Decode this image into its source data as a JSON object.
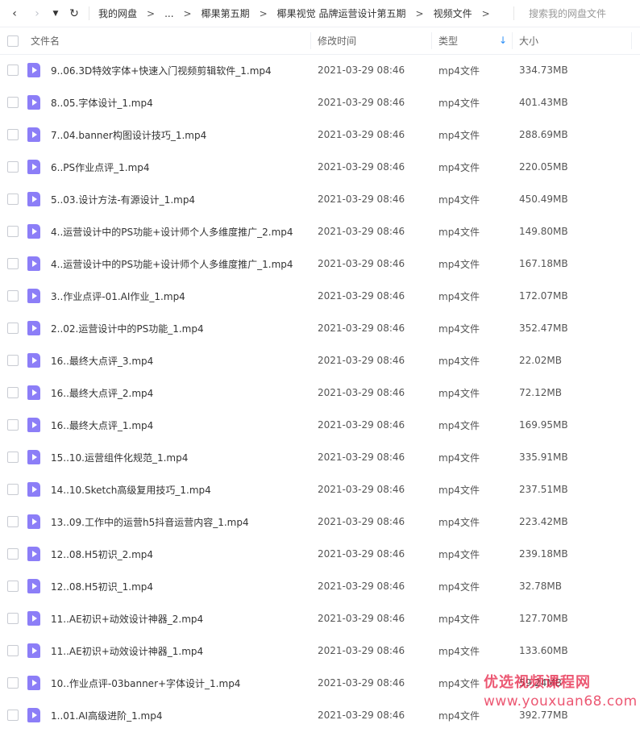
{
  "nav": {
    "back_glyph": "‹",
    "forward_glyph": "›",
    "history_glyph": "▼",
    "refresh_glyph": "↻"
  },
  "breadcrumb": {
    "items": [
      "我的网盘",
      "...",
      "椰果第五期",
      "椰果视觉 品牌运营设计第五期",
      "视频文件"
    ],
    "separator": ">"
  },
  "search": {
    "placeholder": "搜索我的网盘文件"
  },
  "columns": {
    "name": "文件名",
    "modified": "修改时间",
    "type": "类型",
    "size": "大小",
    "sort_glyph": "↓"
  },
  "files": [
    {
      "name": "9..06.3D特效字体+快速入门视频剪辑软件_1.mp4",
      "modified": "2021-03-29 08:46",
      "type": "mp4文件",
      "size": "334.73MB"
    },
    {
      "name": "8..05.字体设计_1.mp4",
      "modified": "2021-03-29 08:46",
      "type": "mp4文件",
      "size": "401.43MB"
    },
    {
      "name": "7..04.banner构图设计技巧_1.mp4",
      "modified": "2021-03-29 08:46",
      "type": "mp4文件",
      "size": "288.69MB"
    },
    {
      "name": "6..PS作业点评_1.mp4",
      "modified": "2021-03-29 08:46",
      "type": "mp4文件",
      "size": "220.05MB"
    },
    {
      "name": "5..03.设计方法-有源设计_1.mp4",
      "modified": "2021-03-29 08:46",
      "type": "mp4文件",
      "size": "450.49MB"
    },
    {
      "name": "4..运营设计中的PS功能+设计师个人多维度推广_2.mp4",
      "modified": "2021-03-29 08:46",
      "type": "mp4文件",
      "size": "149.80MB"
    },
    {
      "name": "4..运营设计中的PS功能+设计师个人多维度推广_1.mp4",
      "modified": "2021-03-29 08:46",
      "type": "mp4文件",
      "size": "167.18MB"
    },
    {
      "name": "3..作业点评-01.AI作业_1.mp4",
      "modified": "2021-03-29 08:46",
      "type": "mp4文件",
      "size": "172.07MB"
    },
    {
      "name": "2..02.运营设计中的PS功能_1.mp4",
      "modified": "2021-03-29 08:46",
      "type": "mp4文件",
      "size": "352.47MB"
    },
    {
      "name": "16..最终大点评_3.mp4",
      "modified": "2021-03-29 08:46",
      "type": "mp4文件",
      "size": "22.02MB"
    },
    {
      "name": "16..最终大点评_2.mp4",
      "modified": "2021-03-29 08:46",
      "type": "mp4文件",
      "size": "72.12MB"
    },
    {
      "name": "16..最终大点评_1.mp4",
      "modified": "2021-03-29 08:46",
      "type": "mp4文件",
      "size": "169.95MB"
    },
    {
      "name": "15..10.运营组件化规范_1.mp4",
      "modified": "2021-03-29 08:46",
      "type": "mp4文件",
      "size": "335.91MB"
    },
    {
      "name": "14..10.Sketch高级复用技巧_1.mp4",
      "modified": "2021-03-29 08:46",
      "type": "mp4文件",
      "size": "237.51MB"
    },
    {
      "name": "13..09.工作中的运营h5抖音运营内容_1.mp4",
      "modified": "2021-03-29 08:46",
      "type": "mp4文件",
      "size": "223.42MB"
    },
    {
      "name": "12..08.H5初识_2.mp4",
      "modified": "2021-03-29 08:46",
      "type": "mp4文件",
      "size": "239.18MB"
    },
    {
      "name": "12..08.H5初识_1.mp4",
      "modified": "2021-03-29 08:46",
      "type": "mp4文件",
      "size": "32.78MB"
    },
    {
      "name": "11..AE初识+动效设计神器_2.mp4",
      "modified": "2021-03-29 08:46",
      "type": "mp4文件",
      "size": "127.70MB"
    },
    {
      "name": "11..AE初识+动效设计神器_1.mp4",
      "modified": "2021-03-29 08:46",
      "type": "mp4文件",
      "size": "133.60MB"
    },
    {
      "name": "10..作业点评-03banner+字体设计_1.mp4",
      "modified": "2021-03-29 08:46",
      "type": "mp4文件",
      "size": "59.24MB"
    },
    {
      "name": "1..01.AI高级进阶_1.mp4",
      "modified": "2021-03-29 08:46",
      "type": "mp4文件",
      "size": "392.77MB"
    }
  ],
  "watermark": {
    "line1": "优选视频课程网",
    "line2": "www.youxuan68.com"
  },
  "colors": {
    "file_icon": "#8c7ef7",
    "sort_accent": "#2a8ef7",
    "watermark": "#e5173d"
  }
}
